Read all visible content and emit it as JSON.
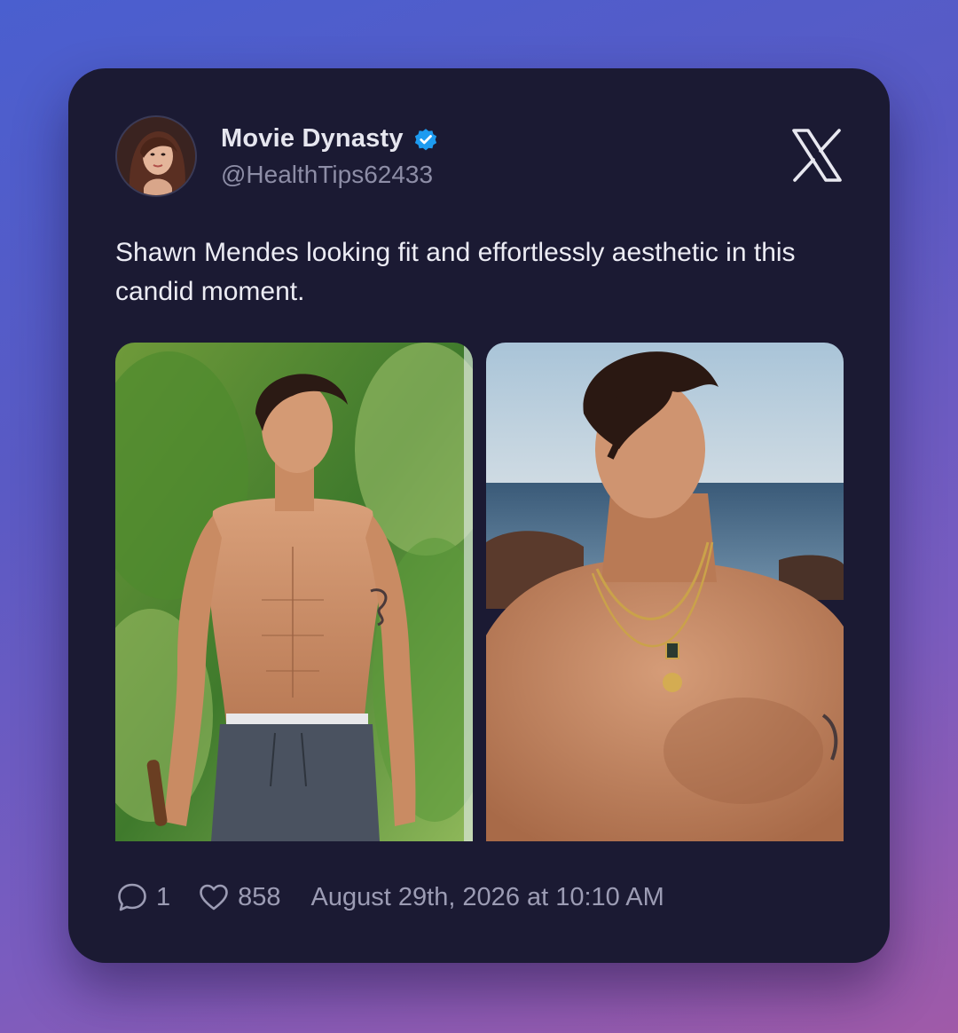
{
  "tweet": {
    "author": {
      "display_name": "Movie Dynasty",
      "handle": "@HealthTips62433",
      "verified": true,
      "verified_color": "#1d9bf0"
    },
    "platform_icon": "x-logo-icon",
    "text": "Shawn Mendes looking fit and effortlessly aesthetic in this candid moment.",
    "media": [
      {
        "description_icon": "photo-shirtless-man-tropical"
      },
      {
        "description_icon": "photo-shirtless-man-beach"
      }
    ],
    "stats": {
      "replies": "1",
      "likes": "858"
    },
    "timestamp": "August 29th, 2026 at 10:10 AM"
  },
  "colors": {
    "card_background": "#1b1a33",
    "text_primary": "#ececf4",
    "text_secondary": "#8d8da6",
    "accent_verified": "#1d9bf0"
  }
}
